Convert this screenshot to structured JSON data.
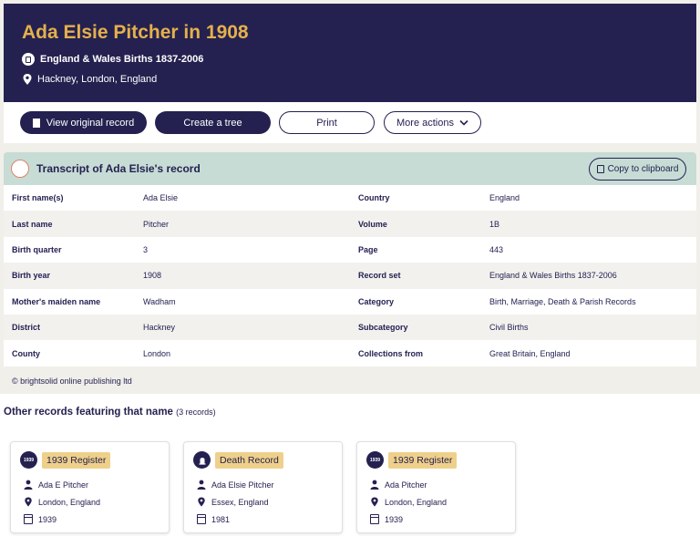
{
  "header": {
    "title": "Ada Elsie Pitcher in 1908",
    "dataset": "England & Wales Births 1837-2006",
    "place": "Hackney, London, England"
  },
  "actions": {
    "view_original": "View original record",
    "create_tree": "Create a tree",
    "print": "Print",
    "more_actions": "More actions"
  },
  "transcript": {
    "title": "Transcript of Ada Elsie's record",
    "copy_label": "Copy to clipboard",
    "rows": [
      {
        "k1": "First name(s)",
        "v1": "Ada Elsie",
        "k2": "Country",
        "v2": "England"
      },
      {
        "k1": "Last name",
        "v1": "Pitcher",
        "k2": "Volume",
        "v2": "1B"
      },
      {
        "k1": "Birth quarter",
        "v1": "3",
        "k2": "Page",
        "v2": "443"
      },
      {
        "k1": "Birth year",
        "v1": "1908",
        "k2": "Record set",
        "v2": "England & Wales Births 1837-2006"
      },
      {
        "k1": "Mother's maiden name",
        "v1": "Wadham",
        "k2": "Category",
        "v2": "Birth, Marriage, Death & Parish Records"
      },
      {
        "k1": "District",
        "v1": "Hackney",
        "k2": "Subcategory",
        "v2": "Civil Births"
      },
      {
        "k1": "County",
        "v1": "London",
        "k2": "Collections from",
        "v2": "Great Britain, England"
      }
    ]
  },
  "copyright": "© brightsolid online publishing ltd",
  "other_records": {
    "title": "Other records featuring that name",
    "count": "(3 records)",
    "cards": [
      {
        "icon_text": "1939",
        "badge": "1939 Register",
        "name": "Ada E Pitcher",
        "place": "London, England",
        "year": "1939"
      },
      {
        "icon_text": "",
        "badge": "Death Record",
        "name": "Ada Elsie Pitcher",
        "place": "Essex, England",
        "year": "1981"
      },
      {
        "icon_text": "1939",
        "badge": "1939 Register",
        "name": "Ada Pitcher",
        "place": "London, England",
        "year": "1939"
      }
    ]
  },
  "colors": {
    "navy": "#242150",
    "gold": "#e5b04b",
    "mint": "#c7dcd5",
    "badge": "#efd08a"
  }
}
